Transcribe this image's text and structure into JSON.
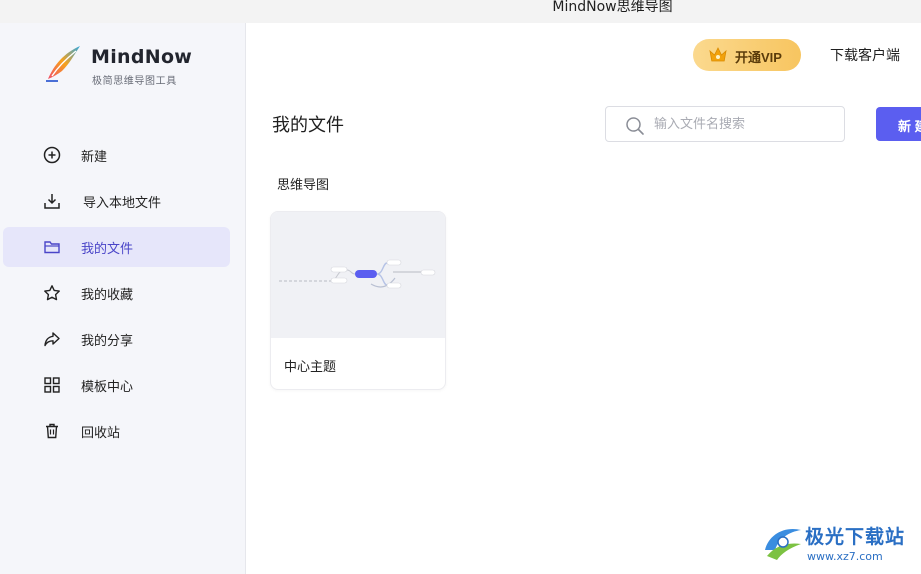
{
  "window": {
    "title": "MindNow思维导图"
  },
  "brand": {
    "name": "MindNow",
    "tagline": "极简思维导图工具"
  },
  "sidebar": {
    "items": [
      {
        "label": "新建",
        "icon": "plus-circle-icon",
        "active": false
      },
      {
        "label": "导入本地文件",
        "icon": "import-icon",
        "active": false
      },
      {
        "label": "我的文件",
        "icon": "folder-icon",
        "active": true
      },
      {
        "label": "我的收藏",
        "icon": "star-icon",
        "active": false
      },
      {
        "label": "我的分享",
        "icon": "share-icon",
        "active": false
      },
      {
        "label": "模板中心",
        "icon": "grid-icon",
        "active": false
      },
      {
        "label": "回收站",
        "icon": "trash-icon",
        "active": false
      }
    ]
  },
  "header": {
    "vip_label": "开通VIP",
    "download_label": "下载客户端"
  },
  "main": {
    "title": "我的文件",
    "search_placeholder": "输入文件名搜索",
    "new_button_label": "新 建",
    "section_label": "思维导图",
    "files": [
      {
        "name": "中心主题"
      }
    ]
  },
  "watermark": {
    "line1": "极光下载站",
    "line2": "www.xz7.com"
  },
  "colors": {
    "accent": "#5b5ef0",
    "active_bg": "#e6e6fa",
    "vip_gold": "#f7c560",
    "sidebar_bg": "#f5f6fa"
  }
}
